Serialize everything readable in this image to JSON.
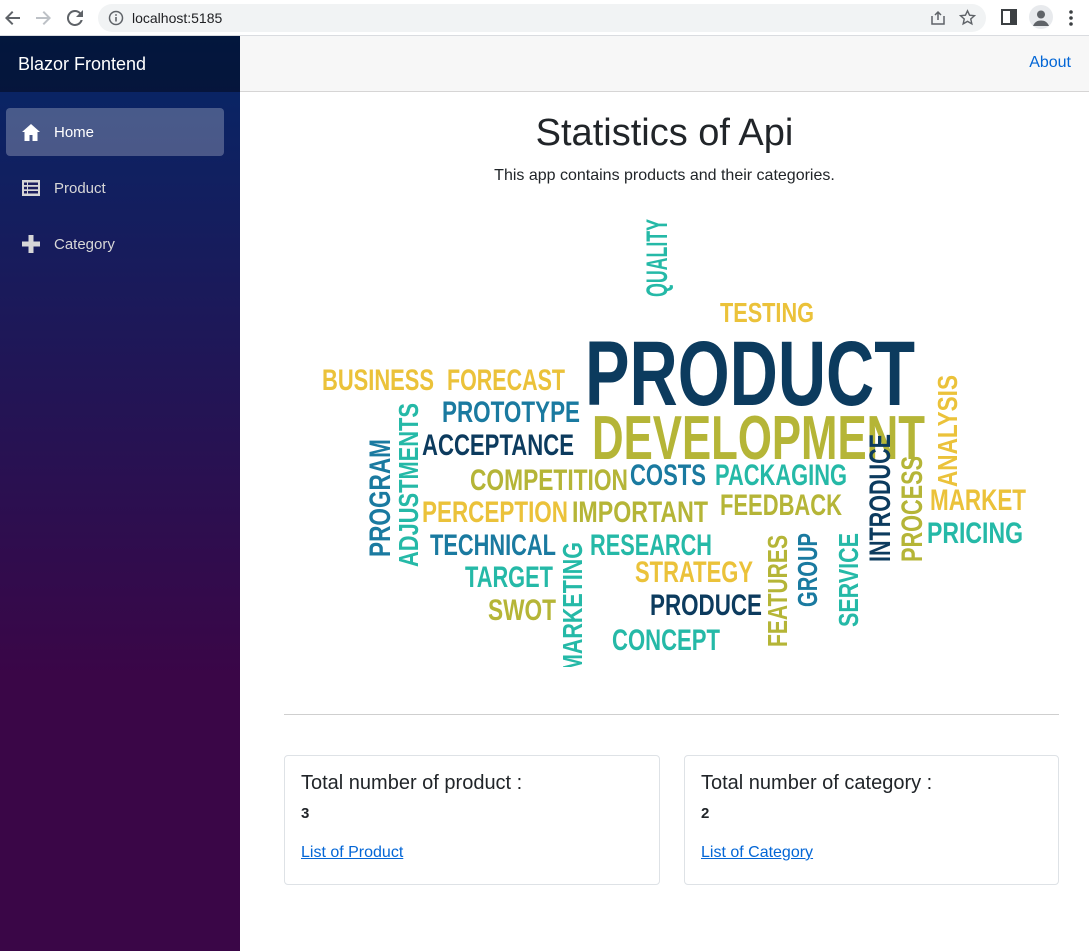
{
  "browser": {
    "url": "localhost:5185"
  },
  "sidebar": {
    "brand": "Blazor Frontend",
    "items": [
      {
        "label": "Home",
        "icon": "home-icon",
        "active": true
      },
      {
        "label": "Product",
        "icon": "list-icon",
        "active": false
      },
      {
        "label": "Category",
        "icon": "plus-icon",
        "active": false
      }
    ]
  },
  "top_row": {
    "about_label": "About"
  },
  "main": {
    "title": "Statistics of Api",
    "subtitle": "This app contains products and their categories.",
    "word_cloud": {
      "words": [
        "PRODUCT",
        "DEVELOPMENT",
        "QUALITY",
        "TESTING",
        "BUSINESS",
        "FORECAST",
        "PROTOTYPE",
        "ACCEPTANCE",
        "ADJUSTMENTS",
        "PROGRAM",
        "COMPETITION",
        "COSTS",
        "PACKAGING",
        "PERCEPTION",
        "IMPORTANT",
        "FEEDBACK",
        "INTRODUCE",
        "PROCESS",
        "ANALYSIS",
        "MARKET",
        "PRICING",
        "TECHNICAL",
        "RESEARCH",
        "TARGET",
        "STRATEGY",
        "FEATURES",
        "GROUP",
        "SERVICE",
        "SWOT",
        "MARKETING",
        "PRODUCE",
        "CONCEPT"
      ]
    },
    "cards": [
      {
        "title": "Total number of product :",
        "count": "3",
        "link": "List of Product"
      },
      {
        "title": "Total number of category :",
        "count": "2",
        "link": "List of Category"
      }
    ]
  },
  "colors": {
    "navy": "#0c3b5e",
    "olive": "#b5b537",
    "teal": "#25b9a7",
    "yellow": "#ebc23a",
    "blue": "#1a7aa0",
    "link": "#0366d6"
  }
}
